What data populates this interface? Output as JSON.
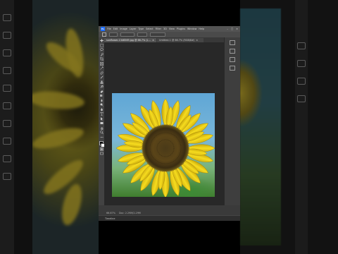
{
  "window": {
    "app_logo": "Ps",
    "menus": [
      "File",
      "Edit",
      "Image",
      "Layer",
      "Type",
      "Select",
      "Filter",
      "3D",
      "View",
      "Plugins",
      "Window",
      "Help"
    ],
    "controls": [
      "–",
      "□",
      "×"
    ]
  },
  "tabs": [
    {
      "label": "sunflower-1346569.jpg @ 66.7% (Layer 0, RGB/8#)",
      "close": "×"
    },
    {
      "label": "Untitled-1 @ 66.7% (RGB/8#)",
      "close": "×"
    }
  ],
  "toolbar": {
    "icons": [
      "move-icon",
      "marquee-icon",
      "lasso-icon",
      "quick-select-icon",
      "crop-icon",
      "frame-icon",
      "eyedropper-icon",
      "healing-icon",
      "brush-icon",
      "clone-stamp-icon",
      "history-brush-icon",
      "eraser-icon",
      "gradient-icon",
      "blur-icon",
      "dodge-icon",
      "pen-icon",
      "type-icon",
      "path-select-icon",
      "rectangle-icon",
      "hand-icon",
      "zoom-icon",
      "more-tools-icon"
    ]
  },
  "status": {
    "zoom": "66.67%",
    "doc_size": "Doc: 2.29M/2.29M"
  },
  "timeline": {
    "label": "Timeline"
  },
  "colors": {
    "foreground": "#000000",
    "background": "#ffffff",
    "ps_accent": "#1c6cff"
  }
}
